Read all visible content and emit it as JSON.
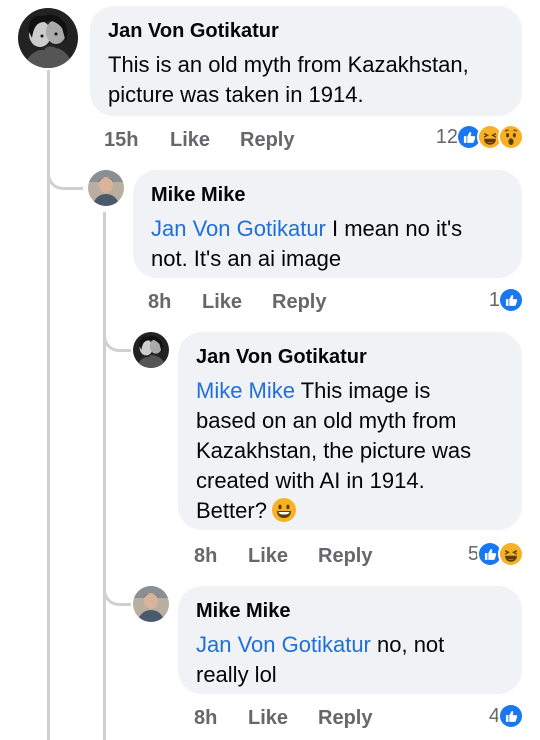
{
  "comments": [
    {
      "author": "Jan Von Gotikatur",
      "text_lines": [
        "This is an old myth from Kazakhstan,",
        "picture was taken in 1914."
      ],
      "time": "15h",
      "like_label": "Like",
      "reply_label": "Reply",
      "reaction_count": "12",
      "reactions": [
        "like-icon",
        "haha-icon",
        "wow-icon"
      ]
    },
    {
      "author": "Mike Mike",
      "mention": "Jan Von Gotikatur",
      "text_line1_rest": " I mean no it's",
      "text_line2": "not. It's an ai image",
      "time": "8h",
      "like_label": "Like",
      "reply_label": "Reply",
      "reaction_count": "1",
      "reactions": [
        "like-icon"
      ]
    },
    {
      "author": "Jan Von Gotikatur",
      "mention": "Mike Mike",
      "text_line1_rest": " This image is",
      "text_line2": "based on an old myth from",
      "text_line3": "Kazakhstan, the picture was",
      "text_line4": "created with AI in 1914.",
      "text_line5": "Better?",
      "inline_emoji": "grinning-face-emoji",
      "time": "8h",
      "like_label": "Like",
      "reply_label": "Reply",
      "reaction_count": "5",
      "reactions": [
        "like-icon",
        "haha-icon"
      ]
    },
    {
      "author": "Mike Mike",
      "mention": "Jan Von Gotikatur",
      "text_line1_rest": " no, not",
      "text_line2": "really lol",
      "time": "8h",
      "like_label": "Like",
      "reply_label": "Reply",
      "reaction_count": "4",
      "reactions": [
        "like-icon"
      ]
    }
  ],
  "colors": {
    "bubble": "#f0f2f5",
    "mention": "#216fdb",
    "meta": "#65676b",
    "like": "#1877f2",
    "emoji": "#f7b125",
    "thread": "#ced0d4"
  }
}
